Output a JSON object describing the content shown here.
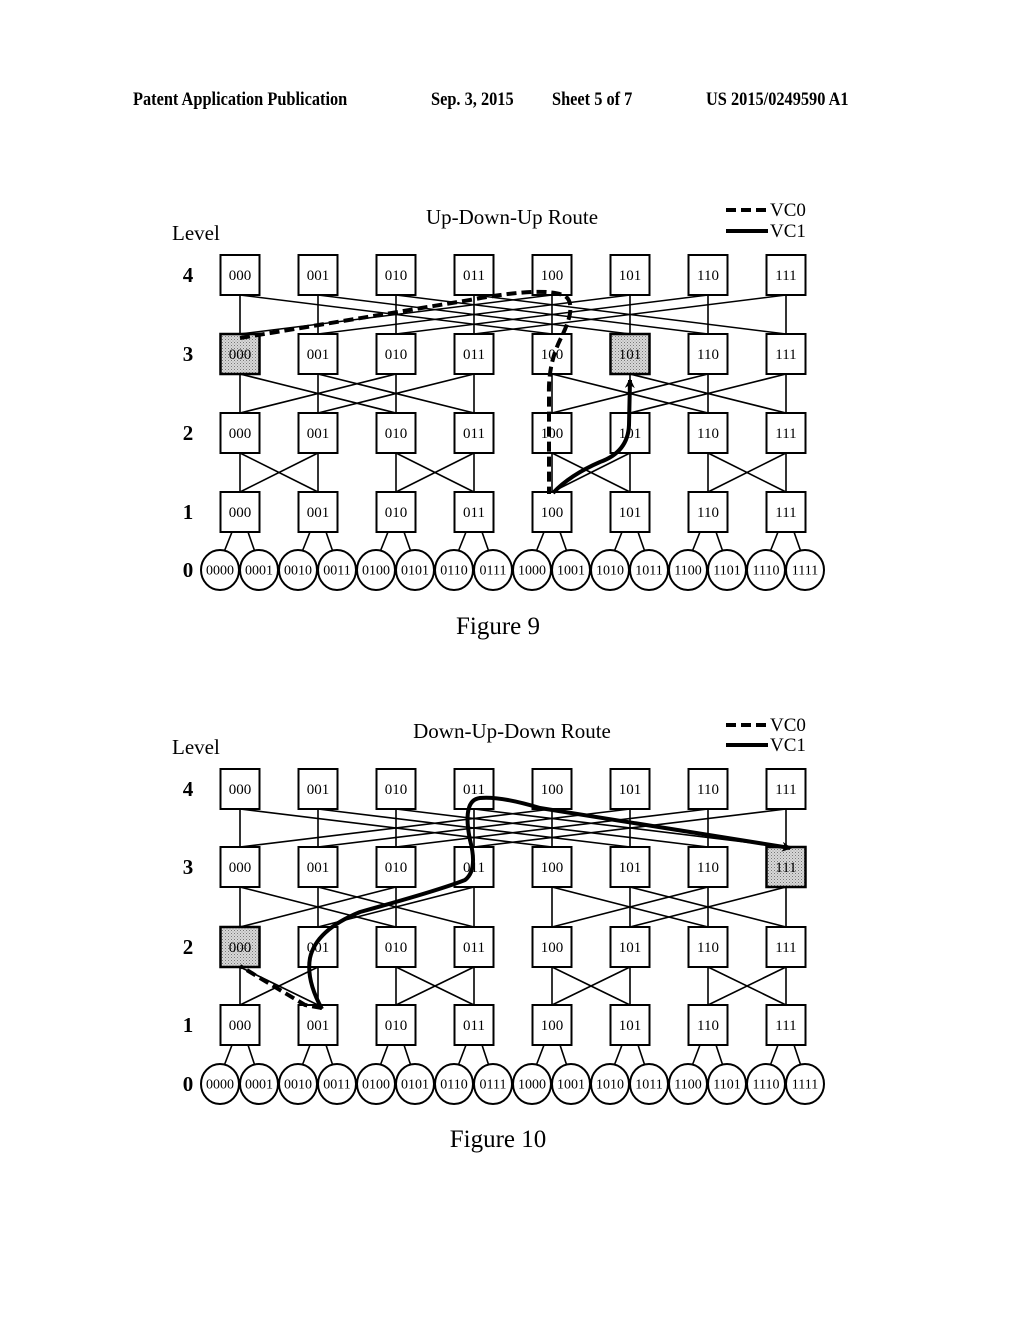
{
  "header": {
    "publication": "Patent Application Publication",
    "date": "Sep. 3, 2015",
    "sheet": "Sheet 5 of 7",
    "number": "US 2015/0249590 A1"
  },
  "legend": {
    "vc0": "VC0",
    "vc1": "VC1"
  },
  "level_word": "Level",
  "levels": [
    "4",
    "3",
    "2",
    "1",
    "0"
  ],
  "switch_labels": [
    "000",
    "001",
    "010",
    "011",
    "100",
    "101",
    "110",
    "111"
  ],
  "node_labels": [
    "0000",
    "0001",
    "0010",
    "0011",
    "0100",
    "0101",
    "0110",
    "0111",
    "1000",
    "1001",
    "1010",
    "1011",
    "1100",
    "1101",
    "1110",
    "1111"
  ],
  "figures": [
    {
      "title": "Up-Down-Up Route",
      "caption": "Figure 9",
      "highlighted": [
        {
          "level": 3,
          "switch": "000"
        },
        {
          "level": 3,
          "switch": "101"
        }
      ],
      "routes": [
        {
          "vc": "VC0",
          "path": "L1:100 → L2:100 → L3:100 → L4:100 → L3:000"
        },
        {
          "vc": "VC1",
          "path": "L1:100 → L2:101 → L3:101"
        }
      ]
    },
    {
      "title": "Down-Up-Down Route",
      "caption": "Figure 10",
      "highlighted": [
        {
          "level": 2,
          "switch": "000"
        },
        {
          "level": 3,
          "switch": "111"
        }
      ],
      "routes": [
        {
          "vc": "VC0",
          "path": "L2:000 → L1:001"
        },
        {
          "vc": "VC1",
          "path": "L1:001 → L2:001 → L3:011 → L4:011 → L3:111"
        }
      ]
    }
  ]
}
